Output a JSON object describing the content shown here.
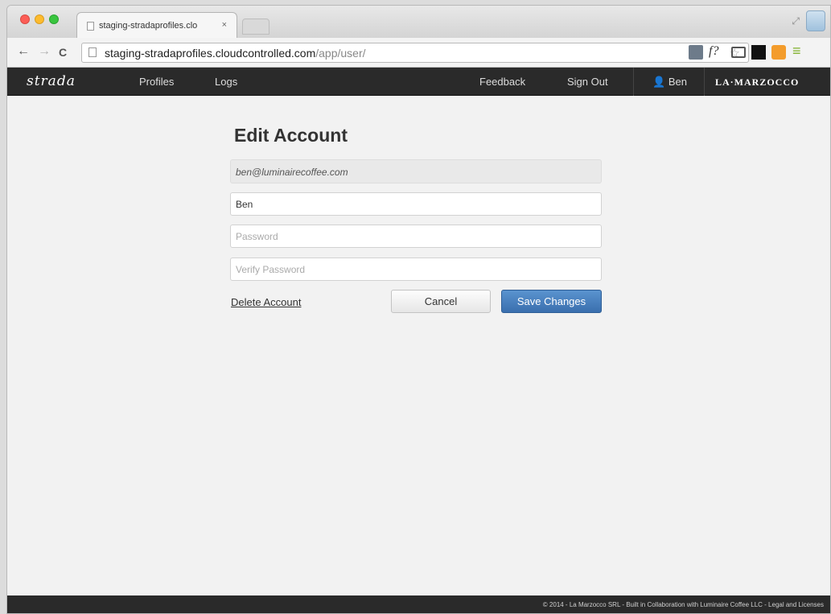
{
  "browser": {
    "tab_title": "staging-stradaprofiles.clo",
    "tab_close": "×",
    "url_host": "staging-stradaprofiles.cloudcontrolled.com",
    "url_path": "/app/user/",
    "ext_f_label": "f?",
    "ext_menu_label": "≡"
  },
  "nav": {
    "brand": "strada",
    "links": {
      "profiles": "Profiles",
      "logs": "Logs",
      "feedback": "Feedback",
      "sign_out": "Sign Out",
      "user": "Ben"
    },
    "partner_logo": "LA·MARZOCCO"
  },
  "form": {
    "heading": "Edit Account",
    "email": "ben@luminairecoffee.com",
    "name_value": "Ben",
    "password_placeholder": "Password",
    "verify_placeholder": "Verify Password",
    "delete_label": "Delete Account",
    "cancel_label": "Cancel",
    "save_label": "Save Changes"
  },
  "footer": {
    "text": "© 2014 - La Marzocco SRL - Built in Collaboration with Luminaire Coffee LLC - Legal and Licenses"
  },
  "colors": {
    "nav_bg": "#2a2a2a",
    "primary_button": "#3a6fae",
    "page_bg": "#f2f2f2"
  },
  "icons": [
    "back-icon",
    "forward-icon",
    "reload-icon",
    "star-icon",
    "user-icon",
    "close-icon"
  ]
}
